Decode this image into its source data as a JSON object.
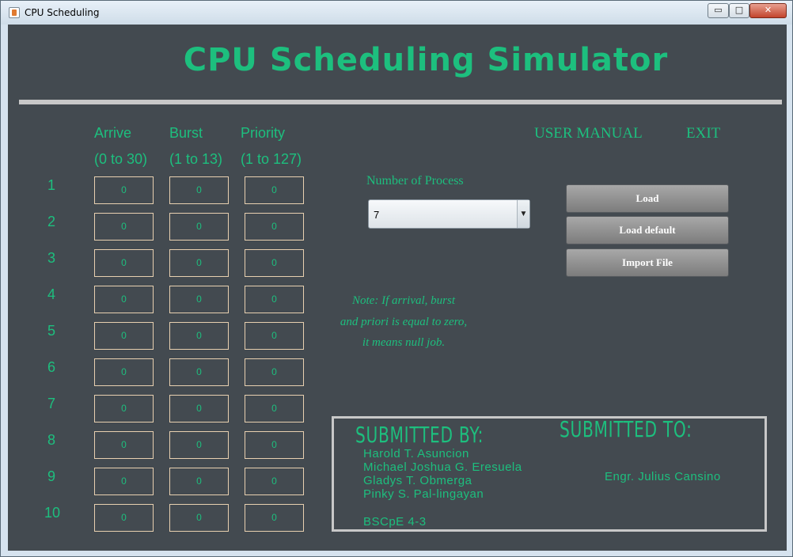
{
  "window": {
    "title": "CPU Scheduling",
    "controls": {
      "minimize": "▭",
      "maximize": "□",
      "close": "✕"
    }
  },
  "header": {
    "title": "CPU Scheduling Simulator"
  },
  "columns": [
    {
      "name": "Arrive",
      "range": "(0 to 30)"
    },
    {
      "name": "Burst",
      "range": "(1 to 13)"
    },
    {
      "name": "Priority",
      "range": "(1 to 127)"
    }
  ],
  "rows": [
    {
      "label": "1",
      "arrive": "0",
      "burst": "0",
      "priority": "0"
    },
    {
      "label": "2",
      "arrive": "0",
      "burst": "0",
      "priority": "0"
    },
    {
      "label": "3",
      "arrive": "0",
      "burst": "0",
      "priority": "0"
    },
    {
      "label": "4",
      "arrive": "0",
      "burst": "0",
      "priority": "0"
    },
    {
      "label": "5",
      "arrive": "0",
      "burst": "0",
      "priority": "0"
    },
    {
      "label": "6",
      "arrive": "0",
      "burst": "0",
      "priority": "0"
    },
    {
      "label": "7",
      "arrive": "0",
      "burst": "0",
      "priority": "0"
    },
    {
      "label": "8",
      "arrive": "0",
      "burst": "0",
      "priority": "0"
    },
    {
      "label": "9",
      "arrive": "0",
      "burst": "0",
      "priority": "0"
    },
    {
      "label": "10",
      "arrive": "0",
      "burst": "0",
      "priority": "0"
    }
  ],
  "menu": {
    "user_manual": "USER MANUAL",
    "exit": "EXIT"
  },
  "process_count": {
    "label": "Number of Process",
    "selected": "7"
  },
  "buttons": {
    "load": "Load",
    "load_default": "Load default",
    "import_file": "Import File"
  },
  "note": [
    "Note: If arrival, burst",
    "and priori is equal to zero,",
    "it means null job."
  ],
  "credits": {
    "submitted_by_label": "SUBMITTED BY:",
    "submitted_to_label": "SUBMITTED TO:",
    "authors": [
      "Harold T. Asuncion",
      "Michael Joshua G. Eresuela",
      "Gladys T. Obmerga",
      "Pinky S. Pal-lingayan"
    ],
    "section": "BSCpE 4-3",
    "adviser": "Engr. Julius Cansino"
  },
  "colors": {
    "accent": "#1dbf7e",
    "panel_bg": "#434a50",
    "button_bg": "#8f8f8f"
  }
}
